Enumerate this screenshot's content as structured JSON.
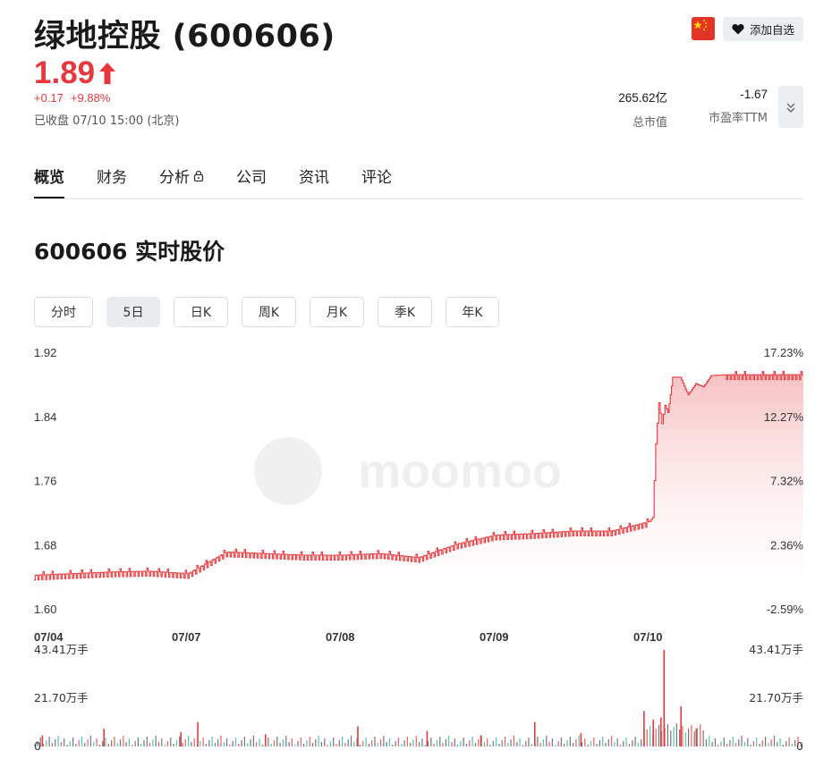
{
  "header": {
    "title": "绿地控股 (600606)",
    "price": "1.89",
    "change": "+0.17",
    "change_pct": "+9.88%",
    "status": "已收盘 07/10 15:00 (北京)",
    "watch_label": "添加自选",
    "flag_icon": "china-flag-icon",
    "up_color": "#e8383d"
  },
  "metrics": [
    {
      "value": "265.62亿",
      "label": "总市值"
    },
    {
      "value": "-1.67",
      "label": "市盈率TTM"
    }
  ],
  "tabs": [
    {
      "label": "概览",
      "active": true
    },
    {
      "label": "财务",
      "active": false
    },
    {
      "label": "分析",
      "active": false,
      "locked": true
    },
    {
      "label": "公司",
      "active": false
    },
    {
      "label": "资讯",
      "active": false
    },
    {
      "label": "评论",
      "active": false
    }
  ],
  "section_title": "600606 实时股价",
  "periods": [
    {
      "label": "分时",
      "active": false
    },
    {
      "label": "5日",
      "active": true
    },
    {
      "label": "日K",
      "active": false
    },
    {
      "label": "周K",
      "active": false
    },
    {
      "label": "月K",
      "active": false
    },
    {
      "label": "季K",
      "active": false
    },
    {
      "label": "年K",
      "active": false
    }
  ],
  "watermark": "moomoo",
  "chart_data": {
    "type": "line",
    "x_labels": [
      "07/04",
      "07/07",
      "07/08",
      "07/09",
      "07/10"
    ],
    "y_ticks": [
      "1.92",
      "1.84",
      "1.76",
      "1.68",
      "1.60"
    ],
    "y_ticks_values": [
      1.92,
      1.84,
      1.76,
      1.68,
      1.6
    ],
    "pct_ticks": [
      "17.23%",
      "12.27%",
      "7.32%",
      "2.36%",
      "-2.59%"
    ],
    "ylim": [
      1.6,
      1.92
    ],
    "x_range": [
      0,
      5
    ],
    "series": [
      {
        "color": "#e8383d",
        "x": [
          0,
          0.25,
          0.5,
          0.75,
          1.0,
          1.25,
          1.5,
          1.75,
          2.0,
          2.25,
          2.5,
          2.75,
          3.0,
          3.25,
          3.5,
          3.75,
          4.0,
          4.02,
          4.04,
          4.06,
          4.08,
          4.1,
          4.12,
          4.15,
          4.2,
          4.25,
          4.3,
          4.35,
          4.4,
          4.5,
          4.75,
          5.0
        ],
        "values": [
          1.643,
          1.645,
          1.647,
          1.648,
          1.645,
          1.672,
          1.67,
          1.668,
          1.668,
          1.67,
          1.665,
          1.682,
          1.693,
          1.695,
          1.698,
          1.698,
          1.71,
          1.715,
          1.807,
          1.858,
          1.832,
          1.855,
          1.846,
          1.89,
          1.89,
          1.868,
          1.882,
          1.878,
          1.892,
          1.893,
          1.893,
          1.893
        ]
      }
    ],
    "volume": {
      "y_ticks": [
        "43.41万手",
        "21.70万手",
        "0"
      ],
      "ylim": [
        0,
        43.41
      ],
      "unit": "万手",
      "bars": [
        {
          "x": 4.09,
          "value": 43.41
        },
        {
          "x": 4.07,
          "value": 13.0
        },
        {
          "x": 4.02,
          "value": 12.0
        },
        {
          "x": 4.2,
          "value": 18.0
        },
        {
          "x": 3.96,
          "value": 16.0
        },
        {
          "x": 3.25,
          "value": 11.0
        },
        {
          "x": 1.06,
          "value": 11.0
        },
        {
          "x": 0.45,
          "value": 8.0
        },
        {
          "x": 0.95,
          "value": 6.5
        },
        {
          "x": 2.1,
          "value": 9.0
        },
        {
          "x": 2.55,
          "value": 7.0
        },
        {
          "x": 3.55,
          "value": 6.0
        },
        {
          "x": 0.05,
          "value": 5.0
        },
        {
          "x": 1.5,
          "value": 5.5
        },
        {
          "x": 2.9,
          "value": 5.0
        },
        {
          "x": 4.3,
          "value": 8.0
        }
      ]
    }
  }
}
